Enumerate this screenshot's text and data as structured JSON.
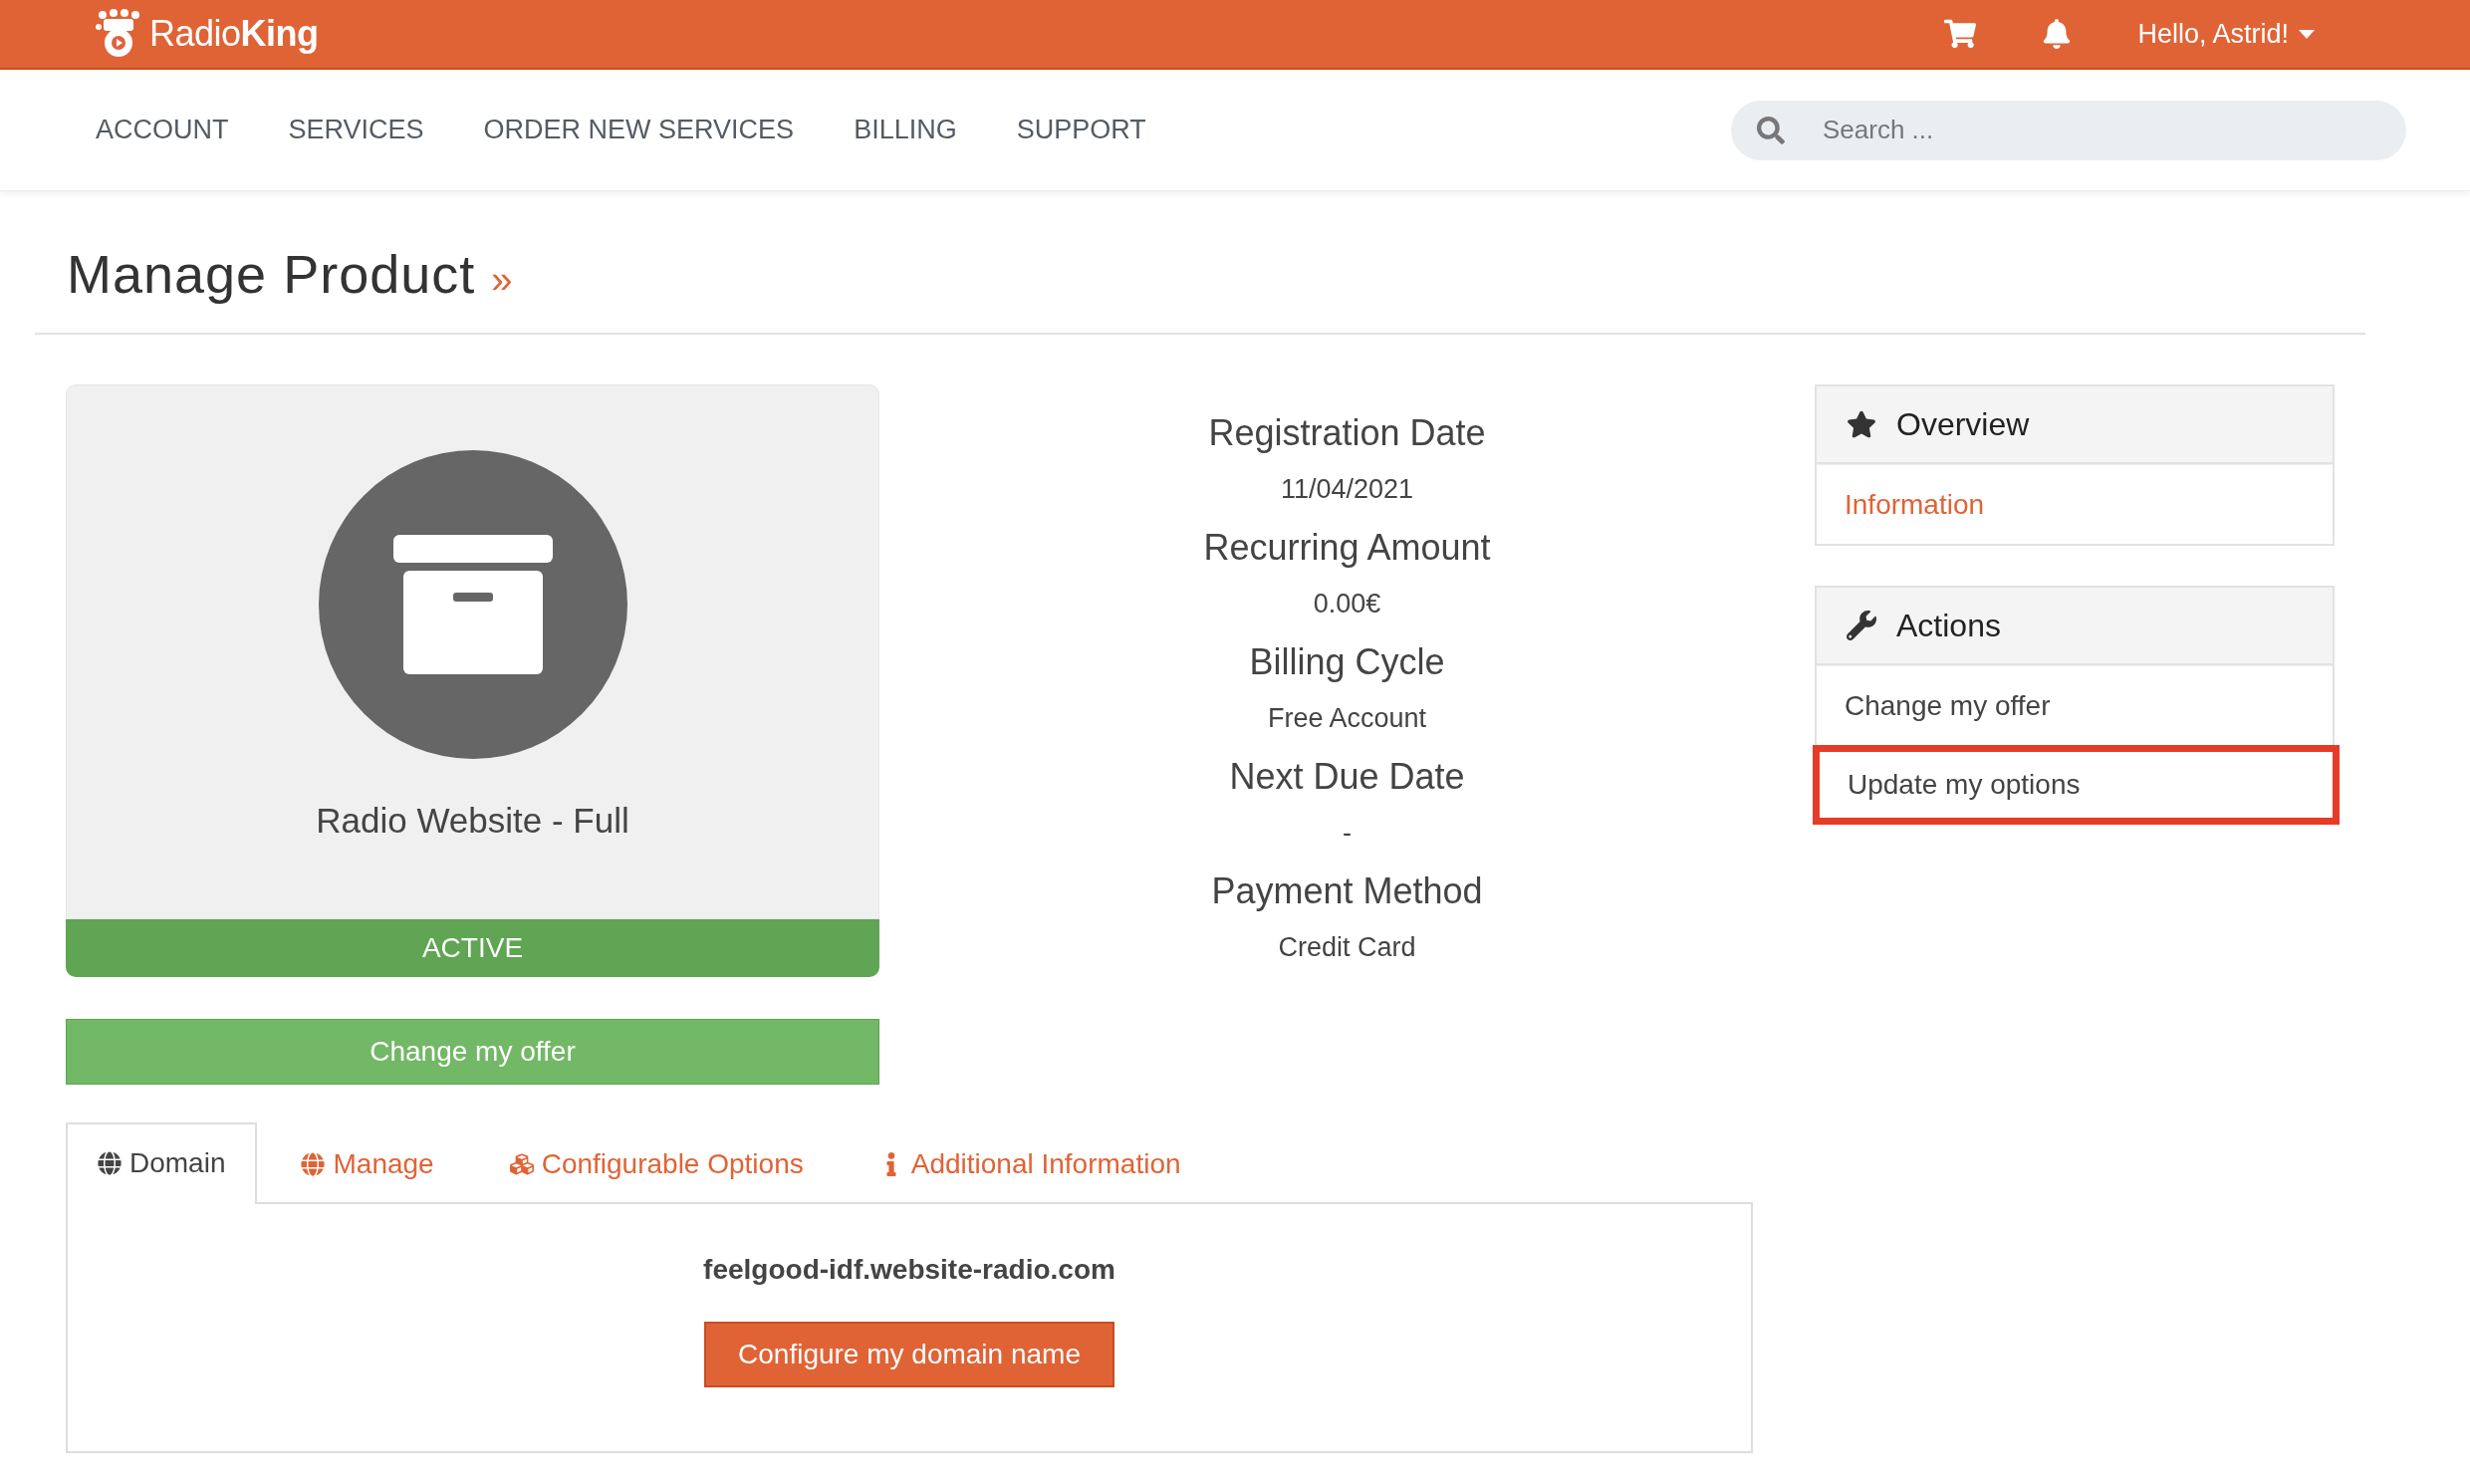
{
  "header": {
    "logo": "Radio**King**",
    "user_menu": "Hello, Astrid!"
  },
  "nav": [
    "ACCOUNT",
    "SERVICES",
    "ORDER NEW SERVICES",
    "BILLING",
    "SUPPORT"
  ],
  "search": {
    "placeholder": "Search ..."
  },
  "page_title": "Manage Product",
  "title_mark": "»",
  "product": {
    "name": "Radio Website - Full",
    "status": "ACTIVE",
    "button": "Change my offer"
  },
  "details": [
    {
      "label": "Registration Date",
      "value": "11/04/2021"
    },
    {
      "label": "Recurring Amount",
      "value": "0.00€"
    },
    {
      "label": "Billing Cycle",
      "value": "Free Account"
    },
    {
      "label": "Next Due Date",
      "value": "-"
    },
    {
      "label": "Payment Method",
      "value": "Credit Card"
    }
  ],
  "sidebar": [
    {
      "title": "Overview",
      "kind": "star",
      "items": [
        {
          "label": "Information",
          "selected": true,
          "highlighted": false
        }
      ]
    },
    {
      "title": "Actions",
      "kind": "wrench",
      "items": [
        {
          "label": "Change my offer",
          "selected": false,
          "highlighted": false
        },
        {
          "label": "Update my options",
          "selected": false,
          "highlighted": true
        }
      ]
    }
  ],
  "tabs": [
    {
      "label": "Domain",
      "kind": "globe",
      "selected": true
    },
    {
      "label": "Manage",
      "kind": "globe",
      "selected": false
    },
    {
      "label": "Configurable Options",
      "kind": "cubes",
      "selected": false
    },
    {
      "label": "Additional Information",
      "kind": "info",
      "selected": false
    }
  ],
  "domain_panel": {
    "domain": "feelgood-idf.website-radio.com",
    "button": "Configure my domain name"
  }
}
